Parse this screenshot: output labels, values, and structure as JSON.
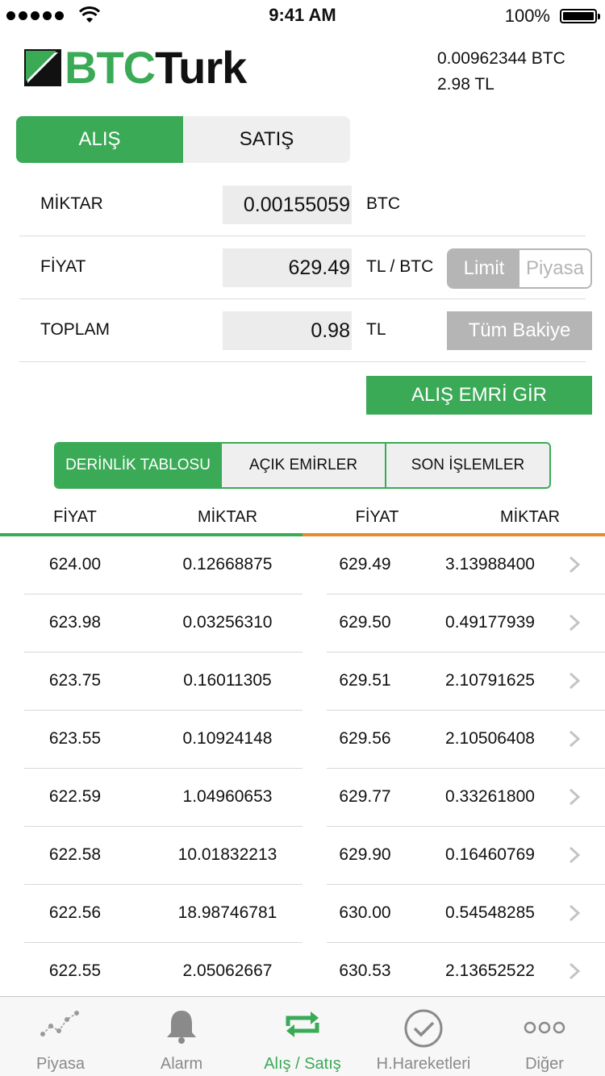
{
  "status_bar": {
    "time": "9:41 AM",
    "battery": "100%"
  },
  "header": {
    "logo_btc": "BTC",
    "logo_turk": "Turk",
    "balance_btc": "0.00962344 BTC",
    "balance_tl": "2.98 TL"
  },
  "trade_tabs": {
    "buy": "ALIŞ",
    "sell": "SATIŞ"
  },
  "form": {
    "amount_label": "MİKTAR",
    "amount_value": "0.00155059",
    "amount_unit": "BTC",
    "price_label": "FİYAT",
    "price_value": "629.49",
    "price_unit": "TL / BTC",
    "total_label": "TOPLAM",
    "total_value": "0.98",
    "total_unit": "TL",
    "order_type_limit": "Limit",
    "order_type_market": "Piyasa",
    "all_balance": "Tüm Bakiye",
    "submit": "ALIŞ EMRİ GİR"
  },
  "sub_tabs": {
    "depth": "DERİNLİK TABLOSU",
    "open_orders": "AÇIK EMİRLER",
    "last_trades": "SON İŞLEMLER"
  },
  "table": {
    "headers": {
      "bid_price": "FİYAT",
      "bid_amount": "MİKTAR",
      "ask_price": "FİYAT",
      "ask_amount": "MİKTAR"
    },
    "rows": [
      {
        "bid_price": "624.00",
        "bid_amount": "0.12668875",
        "ask_price": "629.49",
        "ask_amount": "3.13988400"
      },
      {
        "bid_price": "623.98",
        "bid_amount": "0.03256310",
        "ask_price": "629.50",
        "ask_amount": "0.49177939"
      },
      {
        "bid_price": "623.75",
        "bid_amount": "0.16011305",
        "ask_price": "629.51",
        "ask_amount": "2.10791625"
      },
      {
        "bid_price": "623.55",
        "bid_amount": "0.10924148",
        "ask_price": "629.56",
        "ask_amount": "2.10506408"
      },
      {
        "bid_price": "622.59",
        "bid_amount": "1.04960653",
        "ask_price": "629.77",
        "ask_amount": "0.33261800"
      },
      {
        "bid_price": "622.58",
        "bid_amount": "10.01832213",
        "ask_price": "629.90",
        "ask_amount": "0.16460769"
      },
      {
        "bid_price": "622.56",
        "bid_amount": "18.98746781",
        "ask_price": "630.00",
        "ask_amount": "0.54548285"
      },
      {
        "bid_price": "622.55",
        "bid_amount": "2.05062667",
        "ask_price": "630.53",
        "ask_amount": "2.13652522"
      }
    ]
  },
  "tab_bar": {
    "items": [
      {
        "label": "Piyasa",
        "icon": "chart-line-icon"
      },
      {
        "label": "Alarm",
        "icon": "bell-icon"
      },
      {
        "label": "Alış / Satış",
        "icon": "repeat-icon"
      },
      {
        "label": "H.Hareketleri",
        "icon": "check-circle-icon"
      },
      {
        "label": "Diğer",
        "icon": "more-icon"
      }
    ]
  },
  "colors": {
    "brand_green": "#3aaa56",
    "ask_orange": "#e8892b",
    "disabled_gray": "#b5b5b5"
  }
}
